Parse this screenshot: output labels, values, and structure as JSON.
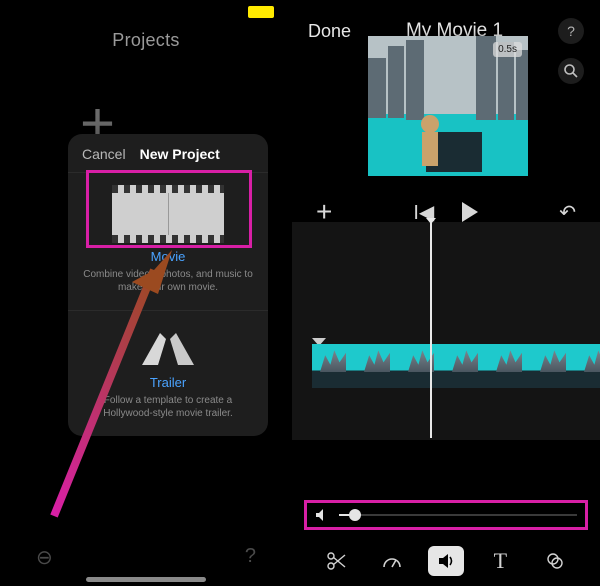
{
  "left": {
    "projects_title": "Projects",
    "cancel_label": "Cancel",
    "new_project_title": "New Project",
    "movie_label": "Movie",
    "movie_desc": "Combine videos, photos, and music to make your own movie.",
    "trailer_label": "Trailer",
    "trailer_desc": "Follow a template to create a Hollywood-style movie trailer."
  },
  "right": {
    "done_label": "Done",
    "movie_title": "My Movie 1",
    "timestamp": "0.5s",
    "volume_percent": 4,
    "tools": {
      "split": "split-tool",
      "speed": "speed-tool",
      "audio": "audio-tool",
      "text": "text-tool",
      "filters": "filters-tool"
    }
  }
}
